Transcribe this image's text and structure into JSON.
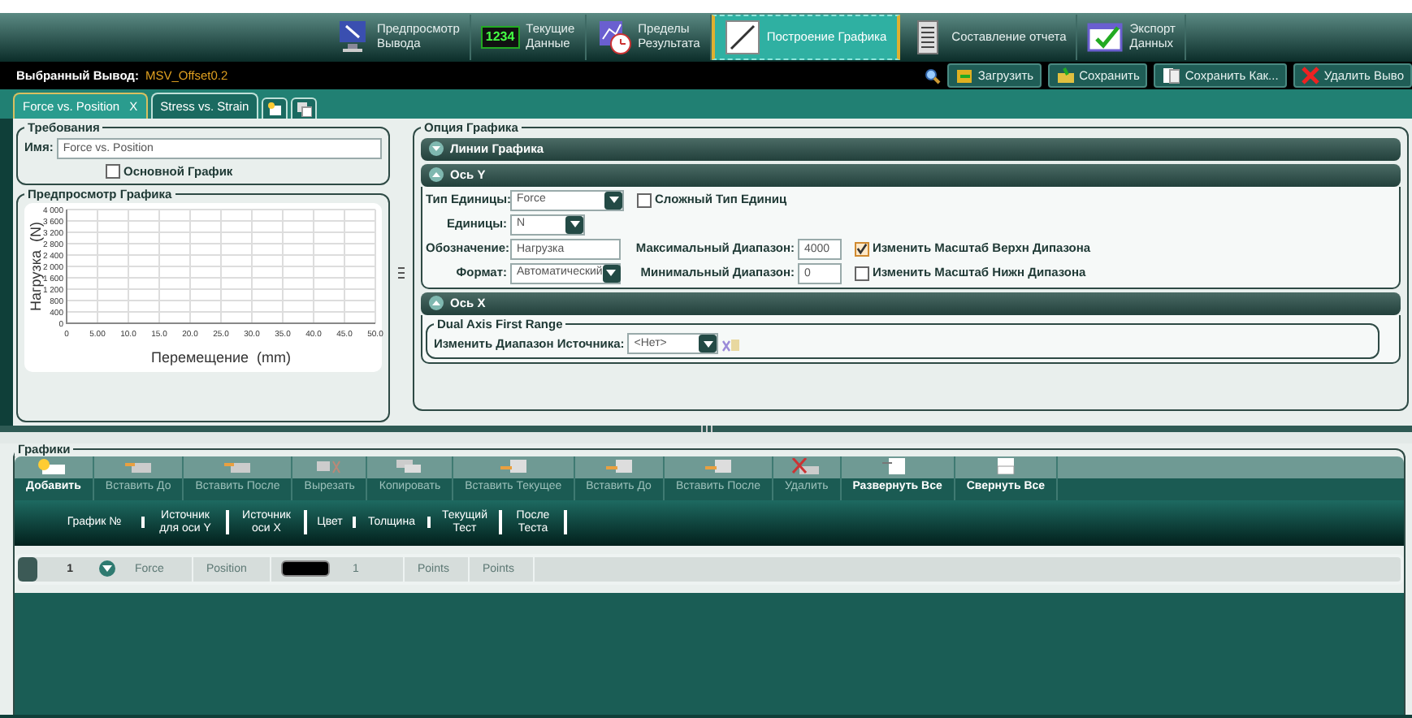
{
  "nav": [
    {
      "kind": "monitor",
      "lines": [
        "Предпросмотр",
        "Вывода"
      ],
      "selected": false
    },
    {
      "kind": "digits",
      "badge": "1234",
      "lines": [
        "Текущие",
        "Данные"
      ],
      "selected": false
    },
    {
      "kind": "limits",
      "lines": [
        "Пределы",
        "Результата"
      ],
      "selected": false
    },
    {
      "kind": "plot",
      "lines": [
        "Построение Графика"
      ],
      "selected": true
    },
    {
      "kind": "report",
      "lines": [
        "Составление отчета"
      ],
      "selected": false
    },
    {
      "kind": "export",
      "lines": [
        "Экспорт",
        "Данных"
      ],
      "selected": false
    }
  ],
  "selected_output": {
    "label": "Выбранный Вывод:",
    "value": "MSV_Offset0.2"
  },
  "actions": [
    {
      "kind": "load",
      "label": "Загрузить"
    },
    {
      "kind": "save",
      "label": "Сохранить"
    },
    {
      "kind": "saveas",
      "label": "Сохранить Как..."
    },
    {
      "kind": "delete",
      "label": "Удалить Выво"
    }
  ],
  "tabs": [
    {
      "label": "Force vs. Position",
      "selected": true,
      "close": "X"
    },
    {
      "label": "Stress vs. Strain",
      "selected": false
    }
  ],
  "requirements": {
    "title": "Требования",
    "name_label": "Имя:",
    "name_value": "Force vs. Position",
    "main_graph": {
      "label": "Основной График",
      "checked": false
    }
  },
  "preview": {
    "title": "Предпросмотр Графика",
    "chart_data": {
      "type": "line",
      "grid": true,
      "xlabel": "Перемещение  (mm)",
      "ylabel": "Нагрузка  (N)",
      "xlim": [
        0,
        50
      ],
      "ylim": [
        0,
        4000
      ],
      "xticks": [
        {
          "value": 0,
          "label": "0"
        },
        {
          "value": 5,
          "label": "5.00"
        },
        {
          "value": 10,
          "label": "10.0"
        },
        {
          "value": 15,
          "label": "15.0"
        },
        {
          "value": 20,
          "label": "20.0"
        },
        {
          "value": 25,
          "label": "25.0"
        },
        {
          "value": 30,
          "label": "30.0"
        },
        {
          "value": 35,
          "label": "35.0"
        },
        {
          "value": 40,
          "label": "40.0"
        },
        {
          "value": 45,
          "label": "45.0"
        },
        {
          "value": 50,
          "label": "50.0"
        }
      ],
      "yticks": [
        {
          "value": 0,
          "label": "0"
        },
        {
          "value": 400,
          "label": "400"
        },
        {
          "value": 800,
          "label": "800"
        },
        {
          "value": 1200,
          "label": "1 200"
        },
        {
          "value": 1600,
          "label": "1 600"
        },
        {
          "value": 2000,
          "label": "2 000"
        },
        {
          "value": 2400,
          "label": "2 400"
        },
        {
          "value": 2800,
          "label": "2 800"
        },
        {
          "value": 3200,
          "label": "3 200"
        },
        {
          "value": 3600,
          "label": "3 600"
        },
        {
          "value": 4000,
          "label": "4 000"
        }
      ]
    }
  },
  "options": {
    "title": "Опция Графика",
    "lines_section": {
      "title": "Линии Графика",
      "expanded": false
    },
    "y_axis": {
      "title": "Ось Y",
      "expanded": true,
      "unit_type": {
        "label": "Тип Единицы:",
        "value": "Force"
      },
      "complex": {
        "label": "Сложный Тип Единиц",
        "checked": false
      },
      "units": {
        "label": "Единицы:",
        "value": "N"
      },
      "designation": {
        "label": "Обозначение:",
        "value": "Нагрузка"
      },
      "max": {
        "label": "Максимальный Диапазон:",
        "value": "4000"
      },
      "rescale_top": {
        "label": "Изменить Масштаб Верхн Дипазона",
        "checked": true
      },
      "format": {
        "label": "Формат:",
        "value": "Автоматический"
      },
      "min": {
        "label": "Минимальный Диапазон:",
        "value": "0"
      },
      "rescale_bottom": {
        "label": "Изменить Масштаб Нижн Дипазона",
        "checked": false
      }
    },
    "x_axis": {
      "title": "Ось X",
      "expanded": true,
      "group_title": "Dual Axis First Range",
      "source": {
        "label": "Изменить Диапазон Источника:",
        "value": "<Нет>"
      }
    }
  },
  "graphs": {
    "title": "Графики",
    "toolbar": [
      {
        "kind": "add",
        "label": "Добавить",
        "disabled": false
      },
      {
        "kind": "insert",
        "label": "Вставить До",
        "disabled": true
      },
      {
        "kind": "insert",
        "label": "Вставить После",
        "disabled": true
      },
      {
        "kind": "cut",
        "label": "Вырезать",
        "disabled": true
      },
      {
        "kind": "copy",
        "label": "Копировать",
        "disabled": true
      },
      {
        "kind": "paste",
        "label": "Вставить Текущее",
        "disabled": true
      },
      {
        "kind": "paste",
        "label": "Вставить До",
        "disabled": true
      },
      {
        "kind": "paste",
        "label": "Вставить После",
        "disabled": true
      },
      {
        "kind": "delete",
        "label": "Удалить",
        "disabled": true
      },
      {
        "kind": "expand",
        "label": "Развернуть Все",
        "disabled": false
      },
      {
        "kind": "collapse",
        "label": "Свернуть Все",
        "disabled": false
      }
    ],
    "columns": [
      "График №",
      "Источник для оси Y",
      "Источник оси X",
      "Цвет",
      "Толщина",
      "Текущий Тест",
      "После Теста"
    ],
    "rows": [
      {
        "number": "1",
        "expanded": false,
        "y_source": "Force",
        "x_source": "Position",
        "color": "#000000",
        "thickness": "1",
        "current_test": "Points",
        "after_test": "Points"
      }
    ]
  }
}
